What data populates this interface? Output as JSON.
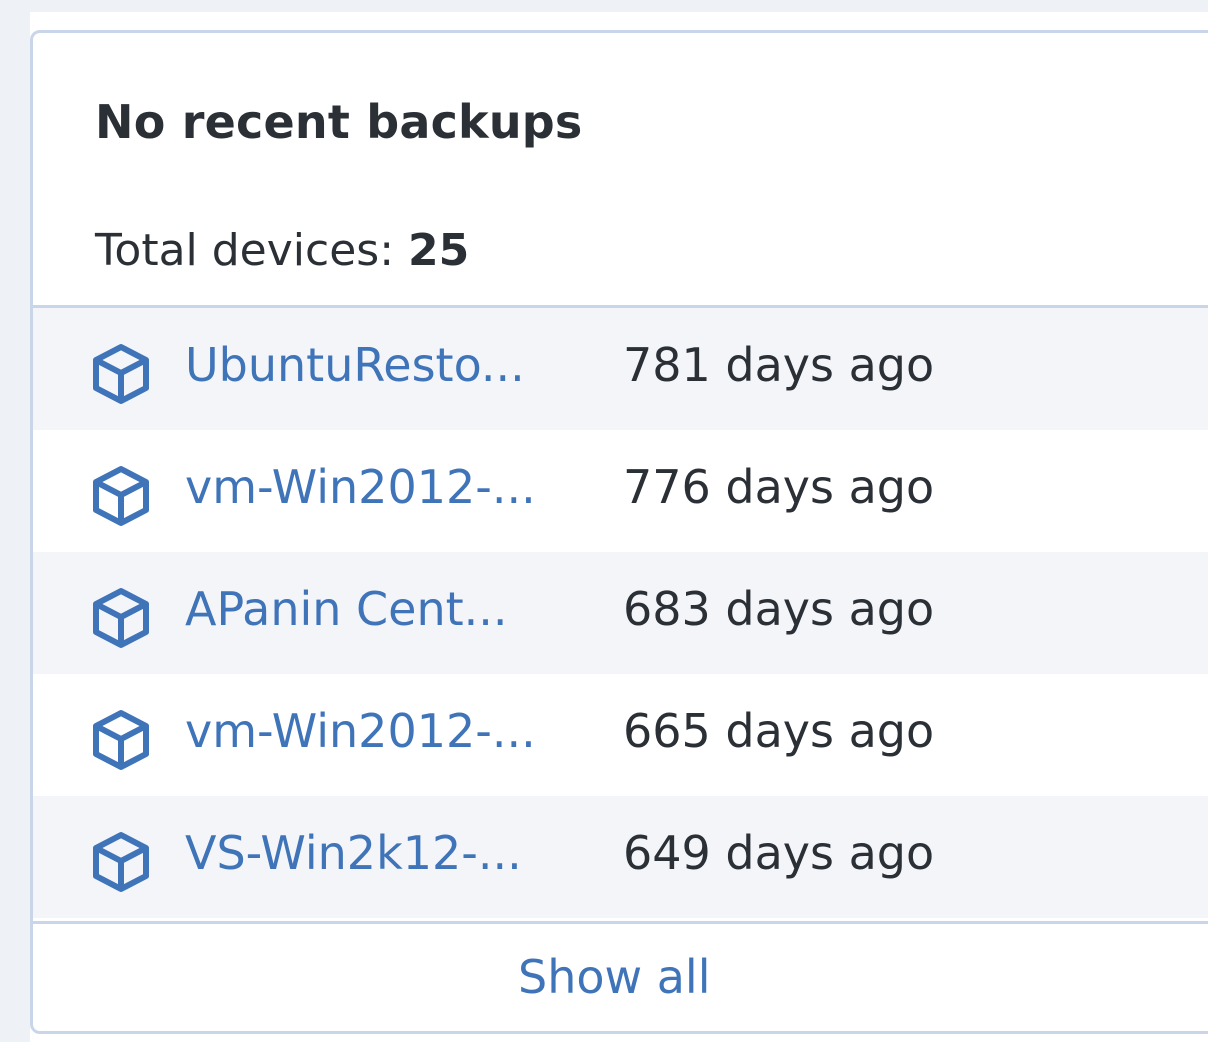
{
  "widget": {
    "title": "No recent backups",
    "total_label": "Total devices:",
    "total_value": "25",
    "show_all_label": "Show all",
    "accent_color": "#3f74b9"
  },
  "devices": [
    {
      "name": "UbuntuResto...",
      "age": "781 days ago",
      "icon": "cube-icon"
    },
    {
      "name": "vm-Win2012-...",
      "age": "776 days ago",
      "icon": "cube-icon"
    },
    {
      "name": "APanin Cent...",
      "age": "683 days ago",
      "icon": "cube-icon"
    },
    {
      "name": "vm-Win2012-...",
      "age": "665 days ago",
      "icon": "cube-icon"
    },
    {
      "name": "VS-Win2k12-...",
      "age": "649 days ago",
      "icon": "cube-icon"
    }
  ]
}
